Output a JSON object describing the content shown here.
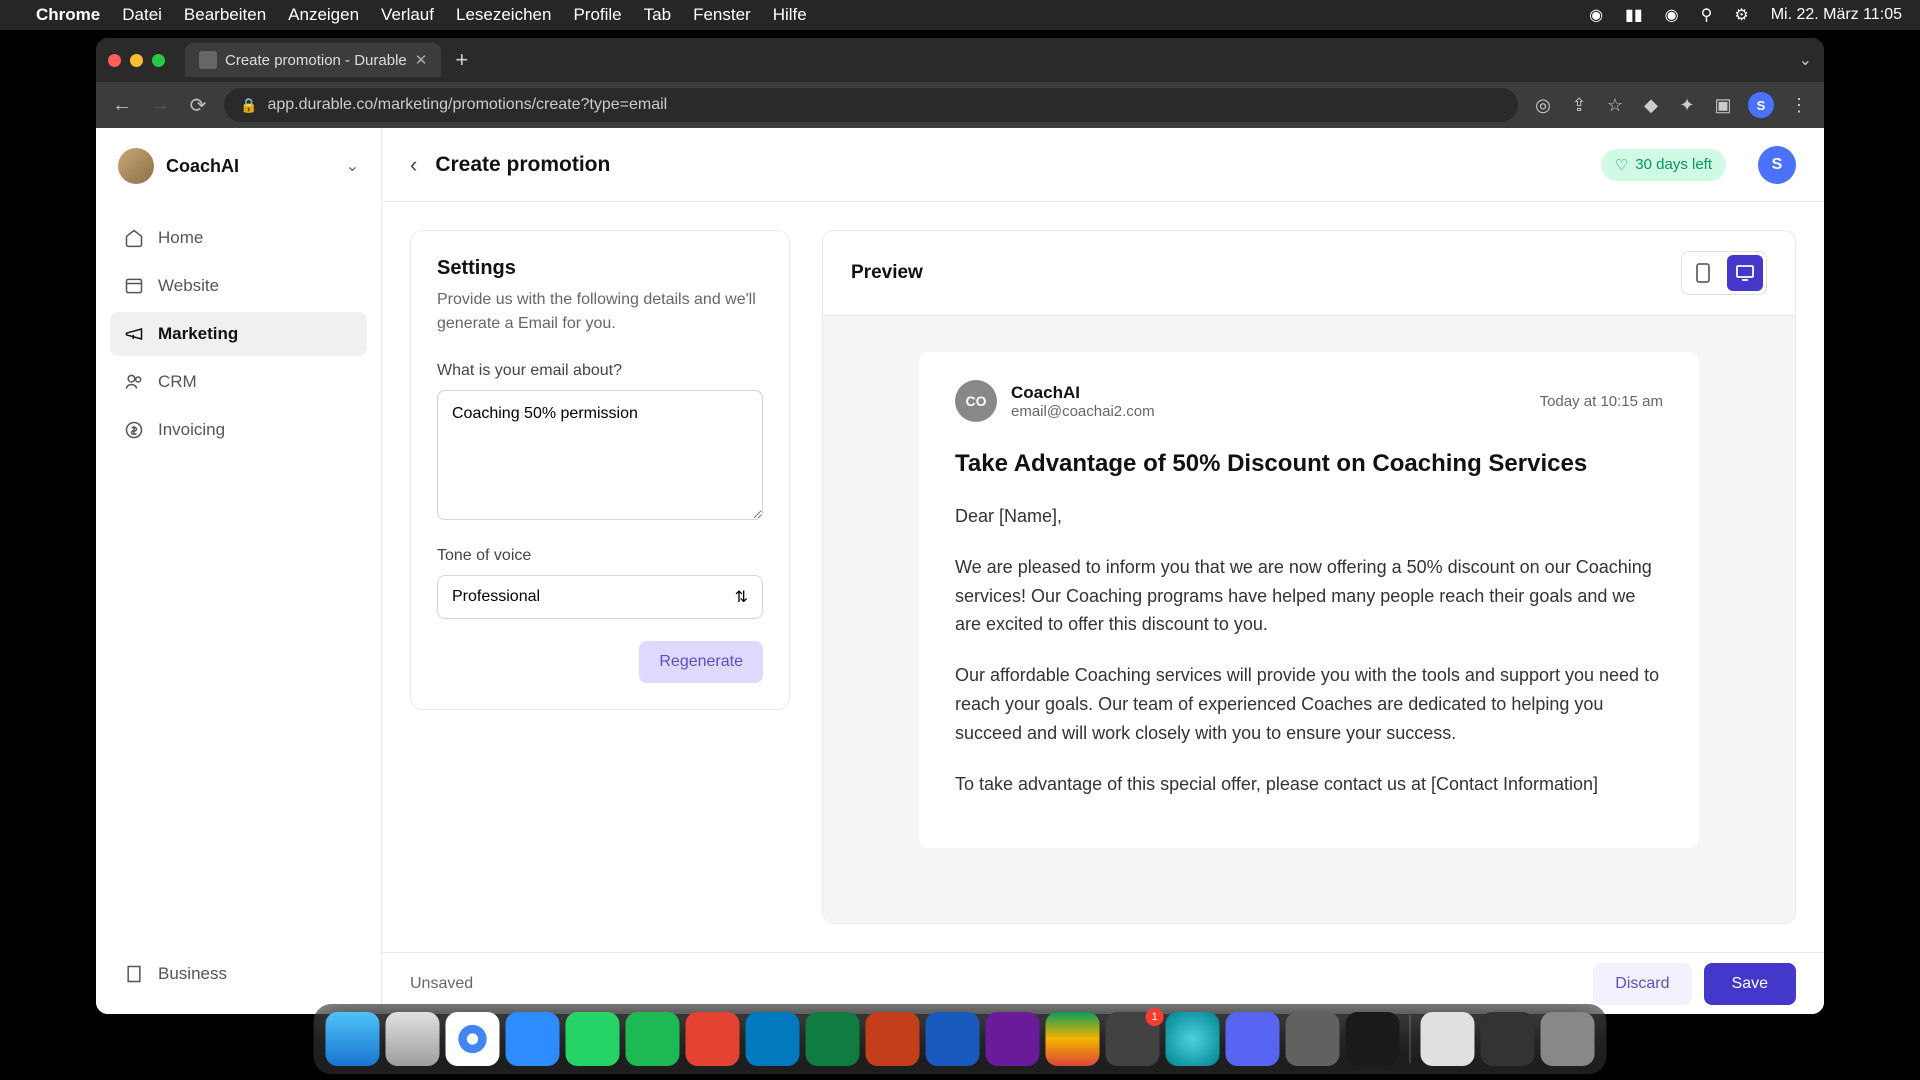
{
  "menubar": {
    "app": "Chrome",
    "items": [
      "Datei",
      "Bearbeiten",
      "Anzeigen",
      "Verlauf",
      "Lesezeichen",
      "Profile",
      "Tab",
      "Fenster",
      "Hilfe"
    ],
    "clock": "Mi. 22. März  11:05"
  },
  "browser": {
    "tab_title": "Create promotion - Durable",
    "url": "app.durable.co/marketing/promotions/create?type=email",
    "avatar_letter": "S"
  },
  "sidebar": {
    "org_name": "CoachAI",
    "items": [
      {
        "label": "Home",
        "icon": "home"
      },
      {
        "label": "Website",
        "icon": "window"
      },
      {
        "label": "Marketing",
        "icon": "megaphone",
        "active": true
      },
      {
        "label": "CRM",
        "icon": "users"
      },
      {
        "label": "Invoicing",
        "icon": "dollar"
      }
    ],
    "bottom_item": {
      "label": "Business",
      "icon": "building"
    }
  },
  "header": {
    "title": "Create promotion",
    "trial_label": "30 days left",
    "avatar_letter": "S"
  },
  "settings": {
    "title": "Settings",
    "description": "Provide us with the following details and we'll generate a Email for you.",
    "about_label": "What is your email about?",
    "about_value": "Coaching 50% permission",
    "tone_label": "Tone of voice",
    "tone_value": "Professional",
    "regenerate_label": "Regenerate"
  },
  "preview": {
    "title": "Preview",
    "sender_initials": "CO",
    "sender_name": "CoachAI",
    "sender_email": "email@coachai2.com",
    "timestamp": "Today at 10:15 am",
    "subject": "Take Advantage of 50% Discount on Coaching Services",
    "greeting": "Dear [Name],",
    "para1": "We are pleased to inform you that we are now offering a 50% discount on our Coaching services! Our Coaching programs have helped many people reach their goals and we are excited to offer this discount to you.",
    "para2": "Our affordable Coaching services will provide you with the tools and support you need to reach your goals. Our team of experienced Coaches are dedicated to helping you succeed and will work closely with you to ensure your success.",
    "para3": "To take advantage of this special offer, please contact us at [Contact Information]"
  },
  "footer": {
    "status": "Unsaved",
    "discard_label": "Discard",
    "save_label": "Save"
  },
  "dock": {
    "badge_count": "1"
  }
}
